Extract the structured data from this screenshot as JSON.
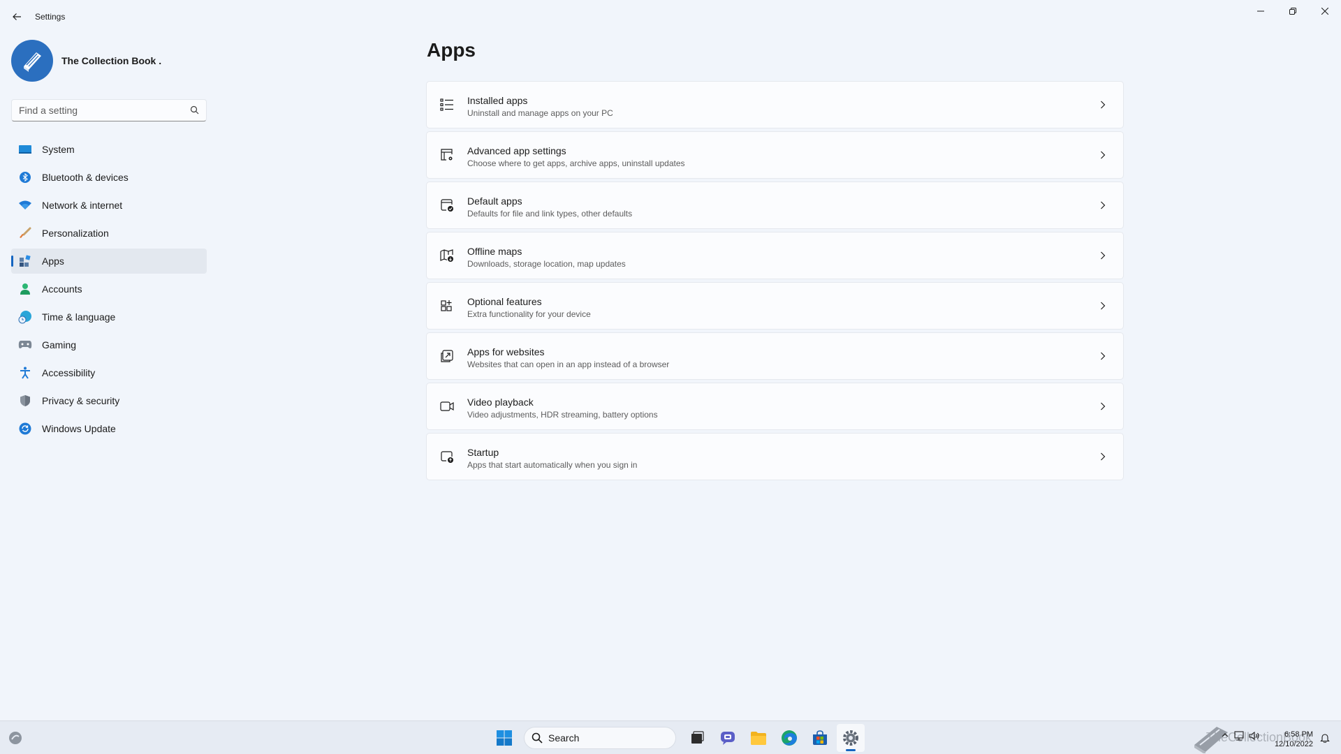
{
  "window": {
    "title": "Settings",
    "back_icon": "back-arrow-icon",
    "controls": [
      "minimize-icon",
      "restore-icon",
      "close-icon"
    ]
  },
  "profile": {
    "name": "The Collection Book .",
    "avatar_icon": "book-avatar-icon"
  },
  "search": {
    "placeholder": "Find a setting",
    "value": ""
  },
  "sidebar": {
    "items": [
      {
        "label": "System",
        "icon": "monitor-icon",
        "active": false
      },
      {
        "label": "Bluetooth & devices",
        "icon": "bluetooth-icon",
        "active": false
      },
      {
        "label": "Network & internet",
        "icon": "wifi-icon",
        "active": false
      },
      {
        "label": "Personalization",
        "icon": "brush-icon",
        "active": false
      },
      {
        "label": "Apps",
        "icon": "apps-icon",
        "active": true
      },
      {
        "label": "Accounts",
        "icon": "person-icon",
        "active": false
      },
      {
        "label": "Time & language",
        "icon": "globe-clock-icon",
        "active": false
      },
      {
        "label": "Gaming",
        "icon": "gamepad-icon",
        "active": false
      },
      {
        "label": "Accessibility",
        "icon": "accessibility-icon",
        "active": false
      },
      {
        "label": "Privacy & security",
        "icon": "shield-icon",
        "active": false
      },
      {
        "label": "Windows Update",
        "icon": "update-icon",
        "active": false
      }
    ]
  },
  "main": {
    "title": "Apps",
    "cards": [
      {
        "title": "Installed apps",
        "description": "Uninstall and manage apps on your PC",
        "icon": "list-icon"
      },
      {
        "title": "Advanced app settings",
        "description": "Choose where to get apps, archive apps, uninstall updates",
        "icon": "app-gear-icon"
      },
      {
        "title": "Default apps",
        "description": "Defaults for file and link types, other defaults",
        "icon": "default-check-icon"
      },
      {
        "title": "Offline maps",
        "description": "Downloads, storage location, map updates",
        "icon": "map-download-icon"
      },
      {
        "title": "Optional features",
        "description": "Extra functionality for your device",
        "icon": "grid-plus-icon"
      },
      {
        "title": "Apps for websites",
        "description": "Websites that can open in an app instead of a browser",
        "icon": "open-external-icon"
      },
      {
        "title": "Video playback",
        "description": "Video adjustments, HDR streaming, battery options",
        "icon": "video-camera-icon"
      },
      {
        "title": "Startup",
        "description": "Apps that start automatically when you sign in",
        "icon": "startup-icon"
      }
    ]
  },
  "taskbar": {
    "search_label": "Search",
    "apps": [
      "start-icon",
      "task-view-icon",
      "chat-icon",
      "file-explorer-icon",
      "edge-icon",
      "store-icon",
      "settings-icon"
    ],
    "active_app": "settings-icon",
    "watermark_text": "TheCollectionBook",
    "time": "6:58 PM",
    "date": "12/10/2022",
    "accent": "#1565c0"
  }
}
